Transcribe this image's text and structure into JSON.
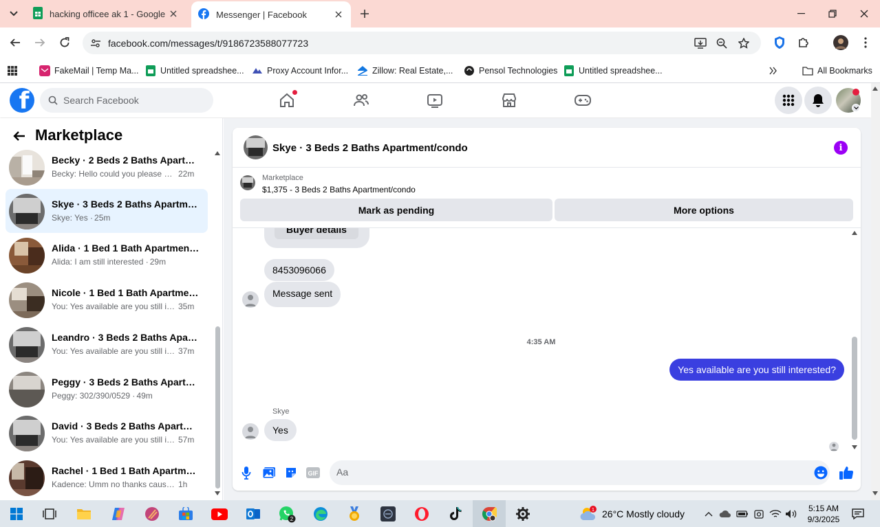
{
  "browser": {
    "tabs": [
      {
        "title": "hacking officee ak 1 - Google Sh",
        "icon": "google-sheets-icon",
        "active": false
      },
      {
        "title": "Messenger | Facebook",
        "icon": "facebook-icon",
        "active": true
      }
    ],
    "url": "facebook.com/messages/t/9186723588077723",
    "bookmarks": [
      {
        "label": "FakeMail | Temp Ma...",
        "icon": "fakemail-icon"
      },
      {
        "label": "Untitled spreadshee...",
        "icon": "google-sheets-icon"
      },
      {
        "label": "Proxy Account Infor...",
        "icon": "proxy-icon"
      },
      {
        "label": "Zillow: Real Estate,...",
        "icon": "zillow-icon"
      },
      {
        "label": "Pensol Technologies",
        "icon": "pensol-icon"
      },
      {
        "label": "Untitled spreadshee...",
        "icon": "google-sheets-icon"
      }
    ],
    "all_bookmarks": "All Bookmarks"
  },
  "facebook": {
    "search_placeholder": "Search Facebook",
    "brand_color": "#1877f2"
  },
  "sidebar": {
    "title": "Marketplace",
    "conversations": [
      {
        "name": "Becky · 2 Beds 2 Baths Apartme...",
        "snippet": "Becky: Hello could you please pr...",
        "time": "22m",
        "active": false
      },
      {
        "name": "Skye · 3 Beds 2 Baths Apartmen...",
        "snippet": "Skye: Yes ·",
        "time": "25m",
        "active": true
      },
      {
        "name": "Alida · 1 Bed 1 Bath Apartment/c...",
        "snippet": "Alida: I am still interested ·",
        "time": "29m",
        "active": false
      },
      {
        "name": "Nicole · 1 Bed 1 Bath Apartment...",
        "snippet": "You: Yes available are you still int...",
        "time": "35m",
        "active": false
      },
      {
        "name": "Leandro · 3 Beds 2 Baths Apart...",
        "snippet": "You: Yes available are you still int...",
        "time": "37m",
        "active": false
      },
      {
        "name": "Peggy · 3 Beds 2 Baths Apartme...",
        "snippet": "Peggy: 302/390/0529 ·",
        "time": "49m",
        "active": false
      },
      {
        "name": "David · 3 Beds 2 Baths Apartme...",
        "snippet": "You: Yes available are you still int...",
        "time": "57m",
        "active": false
      },
      {
        "name": "Rachel · 1 Bed 1 Bath Apartment...",
        "snippet": "Kadence: Umm no thanks cause if ...",
        "time": "1h",
        "active": false
      }
    ]
  },
  "chat": {
    "title": "Skye · 3 Beds 2 Baths Apartment/condo",
    "marketplace_label": "Marketplace",
    "listing": "$1,375 - 3 Beds 2 Baths Apartment/condo",
    "mark_pending": "Mark as pending",
    "more_options": "More options",
    "buyer_details": "Buyer details",
    "messages": [
      {
        "text": "8453096066",
        "direction": "in"
      },
      {
        "text": "Message sent",
        "direction": "in"
      },
      {
        "text": "Yes available are you still  interested?",
        "direction": "out"
      },
      {
        "text": "Yes",
        "direction": "in"
      }
    ],
    "timestamp": "4:35 AM",
    "sender_name": "Skye",
    "composer_placeholder": "Aa",
    "outgoing_color": "#3a3fe0"
  },
  "taskbar": {
    "weather_temp": "26°C",
    "weather_desc": "Mostly cloudy",
    "time": "5:15 AM",
    "date": "9/3/2025",
    "whatsapp_badge": "2",
    "weather_badge": "1"
  }
}
